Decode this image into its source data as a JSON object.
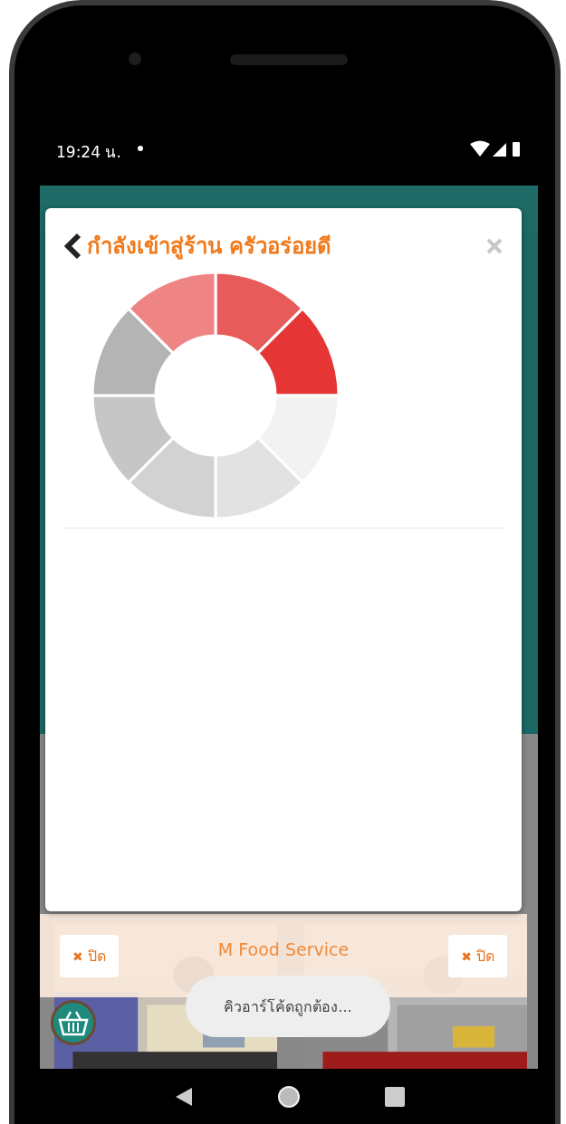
{
  "status_bar": {
    "time": "19:24 น."
  },
  "dialog": {
    "title": "กำลังเข้าสู่ร้าน ครัวอร่อยดี"
  },
  "footer": {
    "title": "M Food Service",
    "buttons": [
      {
        "icon": "✖",
        "label": "ปิด"
      },
      {
        "icon": "✖",
        "label": "ปิด"
      }
    ]
  },
  "toast": {
    "text": "คิวอาร์โค้ดถูกต้อง..."
  }
}
